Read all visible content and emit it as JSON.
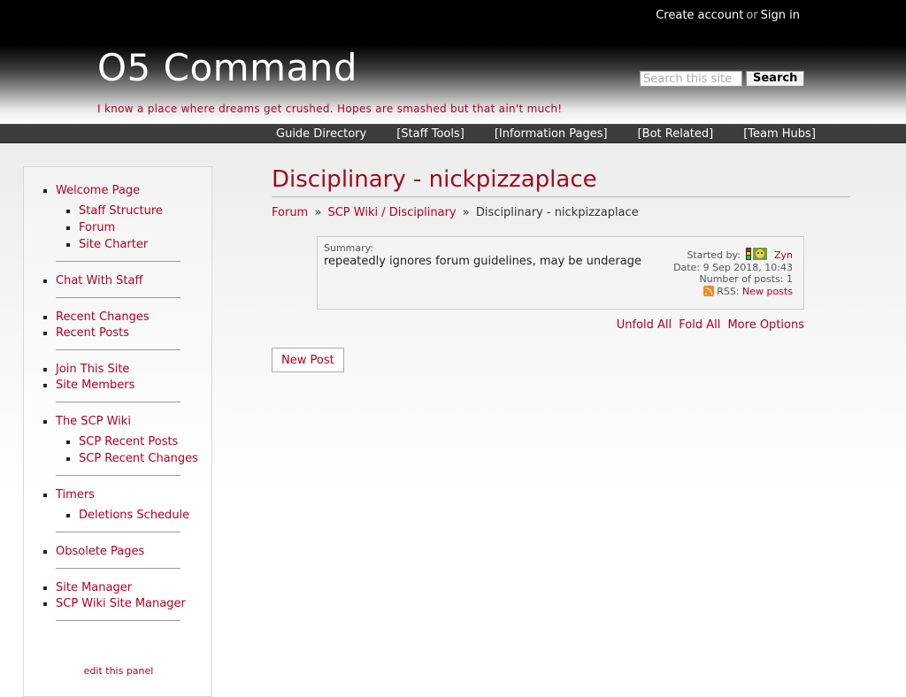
{
  "header": {
    "create_account": "Create account",
    "or": "or",
    "sign_in": "Sign in",
    "site_title": "O5 Command",
    "tagline": "I know a place where dreams get crushed. Hopes are smashed but that ain't much!",
    "search_placeholder": "Search this site",
    "search_button": "Search"
  },
  "top_bar": {
    "items": [
      "Guide Directory",
      "[Staff Tools]",
      "[Information Pages]",
      "[Bot Related]",
      "[Team Hubs]"
    ]
  },
  "sidebar": {
    "welcome": "Welcome Page",
    "staff_structure": "Staff Structure",
    "forum": "Forum",
    "site_charter": "Site Charter",
    "chat_with_staff": "Chat With Staff",
    "recent_changes": "Recent Changes",
    "recent_posts": "Recent Posts",
    "join_site": "Join This Site",
    "site_members": "Site Members",
    "scp_wiki": "The SCP Wiki",
    "scp_recent_posts": "SCP Recent Posts",
    "scp_recent_changes": "SCP Recent Changes",
    "timers": "Timers",
    "deletions_schedule": "Deletions Schedule",
    "obsolete_pages": "Obsolete Pages",
    "site_manager": "Site Manager",
    "scp_wiki_site_manager": "SCP Wiki Site Manager",
    "edit_panel": "edit this panel"
  },
  "main": {
    "page_title": "Disciplinary - nickpizzaplace",
    "breadcrumb": {
      "forum": "Forum",
      "category": "SCP Wiki / Disciplinary",
      "current": "Disciplinary - nickpizzaplace",
      "separator": "»"
    },
    "thread": {
      "summary_label": "Summary:",
      "summary_text": "repeatedly ignores forum guidelines, may be underage",
      "started_by_label": "Started by:",
      "author": "Zyn",
      "date_label": "Date:",
      "date": "9 Sep 2018, 10:43",
      "num_posts_label": "Number of posts:",
      "num_posts": "1",
      "rss_label": "RSS:",
      "rss_link": "New posts"
    },
    "options": {
      "unfold_all": "Unfold All",
      "fold_all": "Fold All",
      "more_options": "More Options"
    },
    "new_post_button": "New Post"
  },
  "colors": {
    "accent": "#b00020",
    "title": "#9e0b1f",
    "top_bar": "#3c3c3c"
  }
}
